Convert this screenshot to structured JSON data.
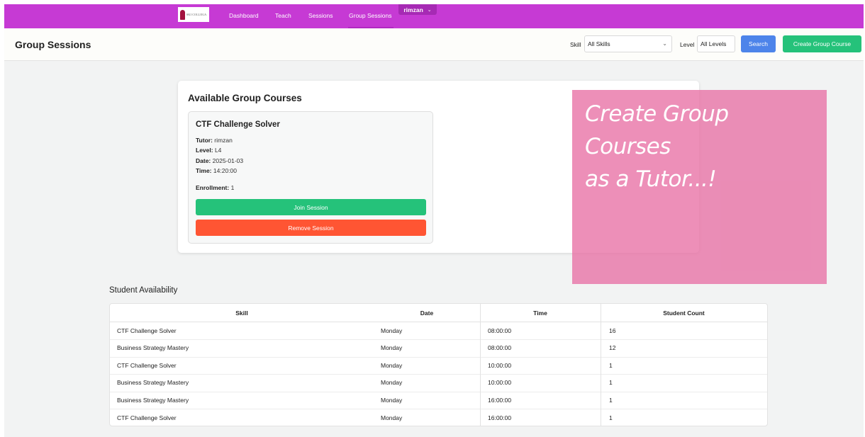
{
  "nav": {
    "logo_text": "SKI COLLEGA",
    "items": [
      "Dashboard",
      "Teach",
      "Sessions",
      "Group Sessions"
    ],
    "user": "rimzan"
  },
  "header": {
    "title": "Group Sessions",
    "skill_label": "Skill",
    "skill_value": "All Skills",
    "level_label": "Level",
    "level_value": "All Levels",
    "search_label": "Search",
    "create_label": "Create Group Course"
  },
  "courses": {
    "title": "Available Group Courses",
    "card": {
      "name": "CTF Challenge Solver",
      "tutor_label": "Tutor:",
      "tutor": "rimzan",
      "level_label": "Level:",
      "level": "L4",
      "date_label": "Date:",
      "date": "2025-01-03",
      "time_label": "Time:",
      "time": "14:20:00",
      "enroll_label": "Enrollment:",
      "enroll": "1",
      "join_label": "Join Session",
      "remove_label": "Remove Session"
    }
  },
  "overlay": {
    "line1": "Create Group Courses",
    "line2": "as a Tutor...!"
  },
  "availability": {
    "title": "Student Availability",
    "headers": [
      "Skill",
      "Date",
      "Time",
      "Student Count"
    ],
    "rows": [
      [
        "CTF Challenge Solver",
        "Monday",
        "08:00:00",
        "16"
      ],
      [
        "Business Strategy Mastery",
        "Monday",
        "08:00:00",
        "12"
      ],
      [
        "CTF Challenge Solver",
        "Monday",
        "10:00:00",
        "1"
      ],
      [
        "Business Strategy Mastery",
        "Monday",
        "10:00:00",
        "1"
      ],
      [
        "Business Strategy Mastery",
        "Monday",
        "16:00:00",
        "1"
      ],
      [
        "CTF Challenge Solver",
        "Monday",
        "16:00:00",
        "1"
      ]
    ]
  },
  "colors": {
    "nav": "#c63ad4",
    "search": "#4d84ea",
    "create": "#25c27a",
    "join": "#25c27a",
    "remove": "#ff5533",
    "overlay": "#e86fa4"
  }
}
